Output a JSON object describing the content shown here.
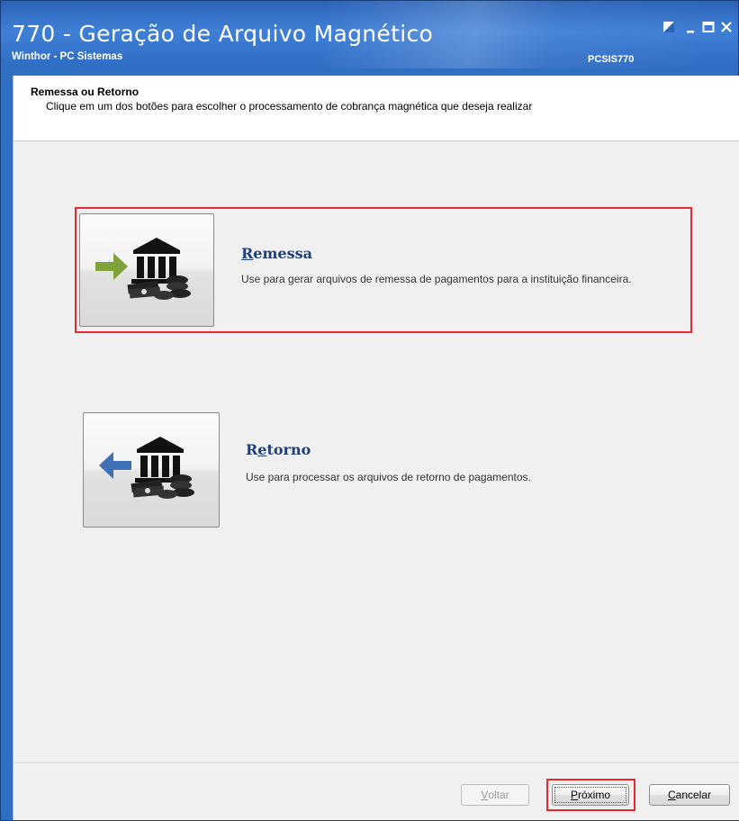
{
  "window": {
    "title": "770 - Geração de Arquivo Magnético",
    "subtitle": "Winthor - PC Sistemas",
    "program_code": "PCSIS770",
    "controls": [
      "restore-icon",
      "minimize-icon",
      "maximize-icon",
      "close-icon"
    ]
  },
  "header": {
    "title": "Remessa ou Retorno",
    "description": "Clique em um dos botões para escolher o processamento de cobrança magnética que deseja realizar"
  },
  "options": [
    {
      "title_first": "R",
      "title_rest": "emessa",
      "description": "Use para gerar arquivos de remessa de pagamentos para a instituição financeira.",
      "icon": "bank-export-icon",
      "arrow_color": "#7fa23a",
      "highlighted": true
    },
    {
      "title_first": "R",
      "title_underlined": "e",
      "title_rest": "torno",
      "description": "Use para processar os arquivos de retorno de pagamentos.",
      "icon": "bank-import-icon",
      "arrow_color": "#3f6fb5",
      "highlighted": false
    }
  ],
  "footer": {
    "back": {
      "mnemonic": "V",
      "rest": "oltar",
      "enabled": false
    },
    "next": {
      "mnemonic": "P",
      "rest": "róximo",
      "enabled": true,
      "highlighted": true
    },
    "cancel": {
      "mnemonic": "C",
      "rest": "ancelar",
      "enabled": true
    }
  },
  "colors": {
    "title_bar": "#3f7fd6",
    "highlight": "#e8282e",
    "option_title": "#1f3f7a"
  }
}
